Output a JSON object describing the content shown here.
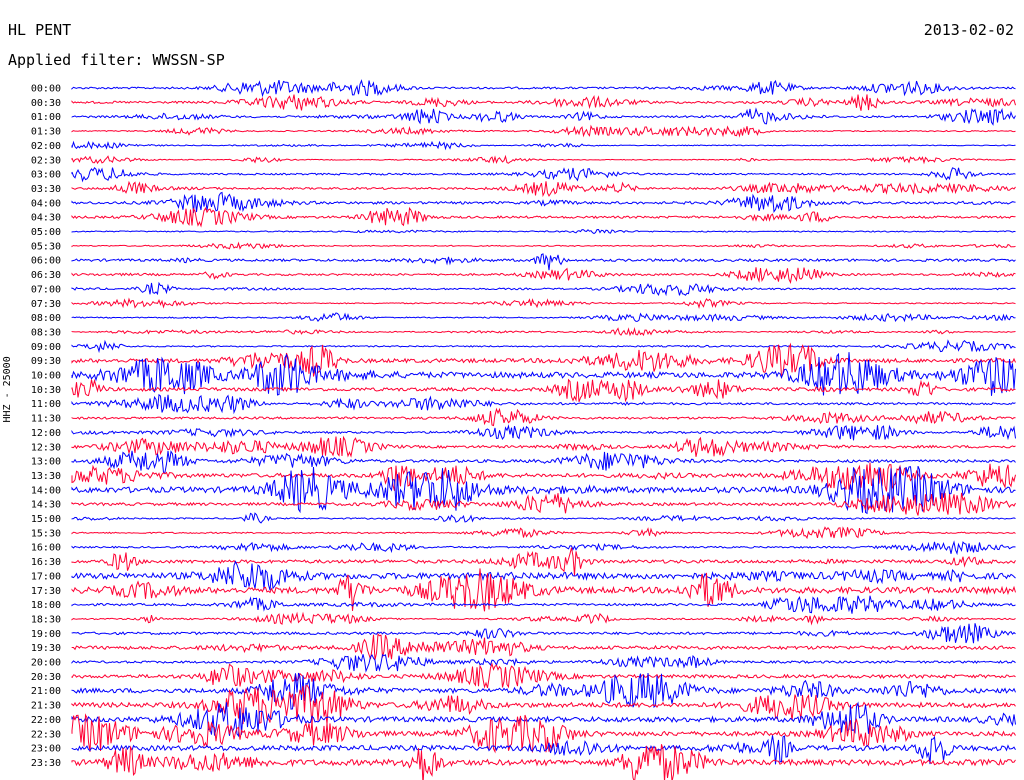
{
  "header": {
    "station": "HL PENT",
    "date": "2013-02-02",
    "filter_label": "Applied filter: WWSSN-SP"
  },
  "axis": {
    "channel_label": "HHZ - 25000"
  },
  "colors": {
    "trace_blue": "#0000ff",
    "trace_red": "#ff0033",
    "background": "#ffffff",
    "text": "#000000"
  },
  "chart_data": {
    "type": "line",
    "title": "",
    "description_kind": "helicorder",
    "trace_colors_alternate": [
      "#0000ff",
      "#ff0033"
    ],
    "rows": [
      {
        "time": "00:00",
        "color": "blue",
        "level": 0.25
      },
      {
        "time": "00:30",
        "color": "red",
        "level": 0.3
      },
      {
        "time": "01:00",
        "color": "blue",
        "level": 0.25
      },
      {
        "time": "01:30",
        "color": "red",
        "level": 0.12
      },
      {
        "time": "02:00",
        "color": "blue",
        "level": 0.06
      },
      {
        "time": "02:30",
        "color": "red",
        "level": 0.06
      },
      {
        "time": "03:00",
        "color": "blue",
        "level": 0.2
      },
      {
        "time": "03:30",
        "color": "red",
        "level": 0.25
      },
      {
        "time": "04:00",
        "color": "blue",
        "level": 0.35
      },
      {
        "time": "04:30",
        "color": "red",
        "level": 0.3
      },
      {
        "time": "05:00",
        "color": "blue",
        "level": 0.12
      },
      {
        "time": "05:30",
        "color": "red",
        "level": 0.1
      },
      {
        "time": "06:00",
        "color": "blue",
        "level": 0.35
      },
      {
        "time": "06:30",
        "color": "red",
        "level": 0.25
      },
      {
        "time": "07:00",
        "color": "blue",
        "level": 0.2
      },
      {
        "time": "07:30",
        "color": "red",
        "level": 0.1
      },
      {
        "time": "08:00",
        "color": "blue",
        "level": 0.12
      },
      {
        "time": "08:30",
        "color": "red",
        "level": 0.1
      },
      {
        "time": "09:00",
        "color": "blue",
        "level": 0.15
      },
      {
        "time": "09:30",
        "color": "red",
        "level": 0.6
      },
      {
        "time": "10:00",
        "color": "blue",
        "level": 0.9
      },
      {
        "time": "10:30",
        "color": "red",
        "level": 0.5
      },
      {
        "time": "11:00",
        "color": "blue",
        "level": 0.3
      },
      {
        "time": "11:30",
        "color": "red",
        "level": 0.3
      },
      {
        "time": "12:00",
        "color": "blue",
        "level": 0.25
      },
      {
        "time": "12:30",
        "color": "red",
        "level": 0.35
      },
      {
        "time": "13:00",
        "color": "blue",
        "level": 0.4
      },
      {
        "time": "13:30",
        "color": "red",
        "level": 0.6
      },
      {
        "time": "14:00",
        "color": "blue",
        "level": 0.9
      },
      {
        "time": "14:30",
        "color": "red",
        "level": 0.4
      },
      {
        "time": "15:00",
        "color": "blue",
        "level": 0.15
      },
      {
        "time": "15:30",
        "color": "red",
        "level": 0.15
      },
      {
        "time": "16:00",
        "color": "blue",
        "level": 0.2
      },
      {
        "time": "16:30",
        "color": "red",
        "level": 0.5
      },
      {
        "time": "17:00",
        "color": "blue",
        "level": 0.95
      },
      {
        "time": "17:30",
        "color": "red",
        "level": 0.95
      },
      {
        "time": "18:00",
        "color": "blue",
        "level": 0.3
      },
      {
        "time": "18:30",
        "color": "red",
        "level": 0.15
      },
      {
        "time": "19:00",
        "color": "blue",
        "level": 0.35
      },
      {
        "time": "19:30",
        "color": "red",
        "level": 0.5
      },
      {
        "time": "20:00",
        "color": "blue",
        "level": 0.3
      },
      {
        "time": "20:30",
        "color": "red",
        "level": 0.5
      },
      {
        "time": "21:00",
        "color": "blue",
        "level": 0.7
      },
      {
        "time": "21:30",
        "color": "red",
        "level": 0.75
      },
      {
        "time": "22:00",
        "color": "blue",
        "level": 0.8
      },
      {
        "time": "22:30",
        "color": "red",
        "level": 0.7
      },
      {
        "time": "23:00",
        "color": "blue",
        "level": 0.8
      },
      {
        "time": "23:30",
        "color": "red",
        "level": 0.9
      }
    ]
  }
}
